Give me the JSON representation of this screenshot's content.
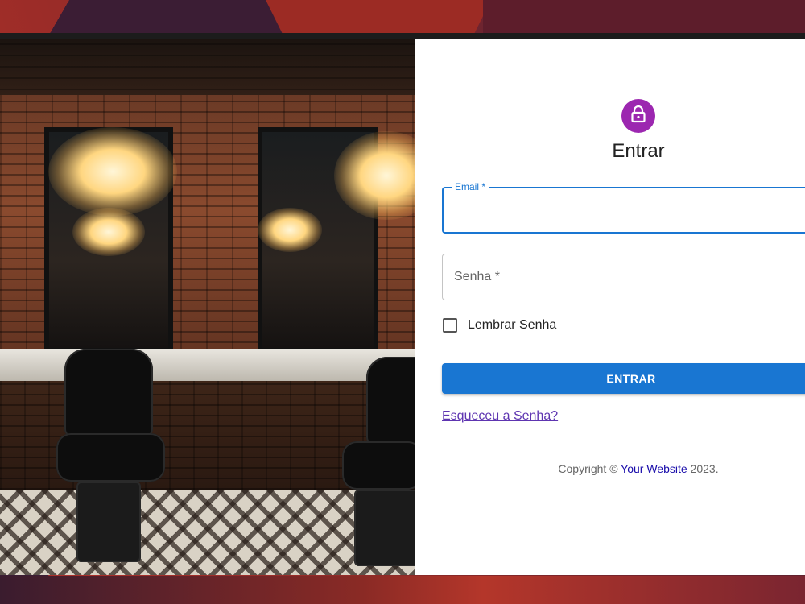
{
  "login": {
    "title": "Entrar",
    "email_label": "Email *",
    "email_value": "",
    "password_placeholder": "Senha *",
    "password_value": "",
    "remember_label": "Lembrar Senha",
    "remember_checked": false,
    "submit_label": "ENTRAR",
    "forgot_link": "Esqueceu a Senha?",
    "lock_icon": "lock-icon",
    "avatar_color": "#9c27b0",
    "primary_color": "#1976d2"
  },
  "footer": {
    "copyright_prefix": "Copyright ©",
    "website_link": "Your Website",
    "year_suffix": "2023."
  },
  "photo": {
    "subject": "barbershop-interior-image"
  }
}
